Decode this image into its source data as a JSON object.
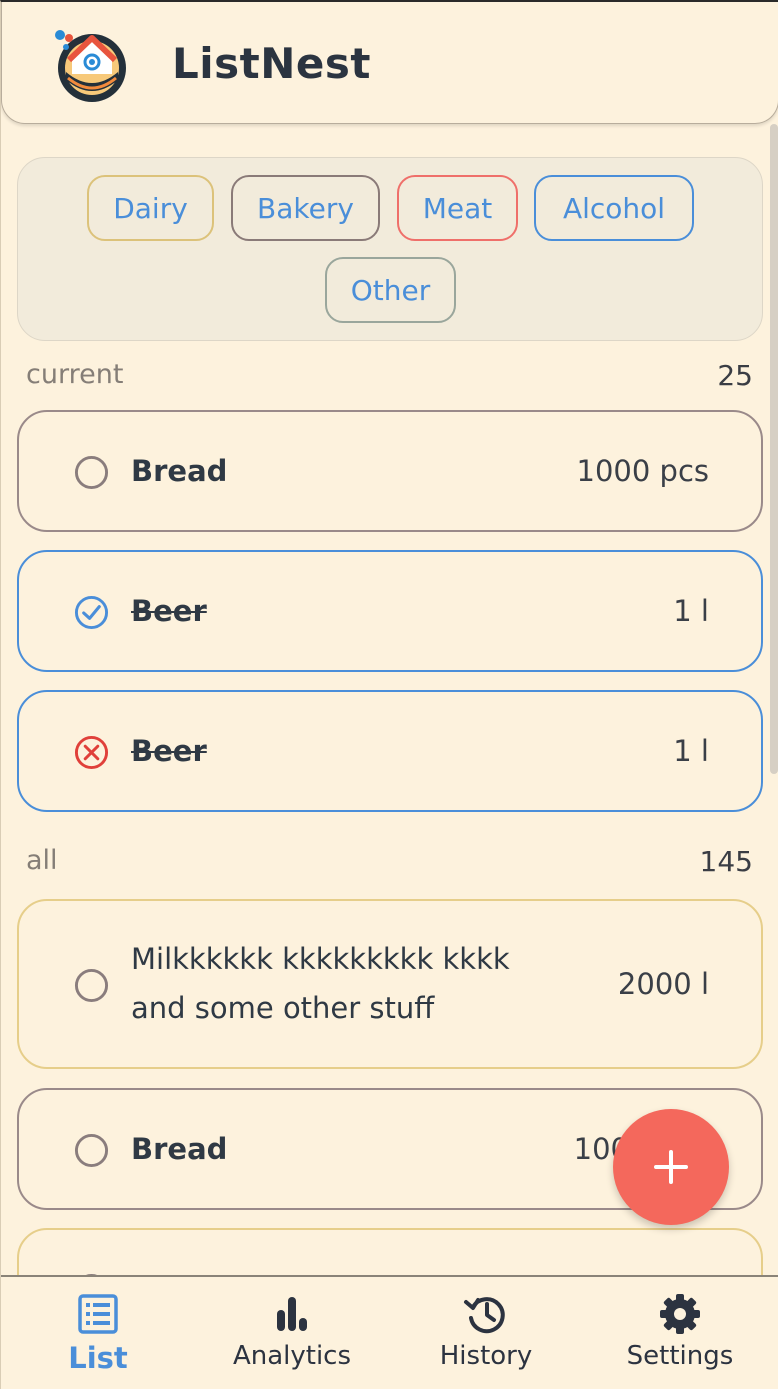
{
  "app": {
    "title": "ListNest"
  },
  "categories": [
    {
      "label": "Dairy",
      "border_color": "#dcc27a"
    },
    {
      "label": "Bakery",
      "border_color": "#8a7a78"
    },
    {
      "label": "Meat",
      "border_color": "#ef6f6a"
    },
    {
      "label": "Alcohol",
      "border_color": "#4a8ed9"
    },
    {
      "label": "Other",
      "border_color": "#9aa69c"
    }
  ],
  "sections": {
    "current": {
      "label": "current",
      "count": "25"
    },
    "all": {
      "label": "all",
      "count": "145"
    }
  },
  "current_items": [
    {
      "name": "Bread",
      "quantity": "1000 pcs",
      "status": "unchecked",
      "category_color": "#9a8a8a"
    },
    {
      "name": "Beer",
      "quantity": "1 l",
      "status": "checked",
      "category_color": "#4a8ed9"
    },
    {
      "name": "Beer",
      "quantity": "1 l",
      "status": "cancelled",
      "category_color": "#4a8ed9"
    }
  ],
  "all_items": [
    {
      "name_line1": "Milkkkkkk kkkkkkkkk kkkk",
      "name_line2": "and some other stuff",
      "quantity": "2000 l",
      "status": "unchecked",
      "category_color": "#e6ce8a"
    },
    {
      "name": "Bread",
      "quantity": "100",
      "status": "unchecked",
      "category_color": "#9a8a8a"
    }
  ],
  "colors": {
    "accent": "#4a8ed9",
    "fab": "#f4685c",
    "background": "#fdf2dd",
    "danger": "#e0403a"
  },
  "fab": {
    "icon": "plus-icon"
  },
  "nav": [
    {
      "label": "List",
      "icon": "list-icon",
      "active": true
    },
    {
      "label": "Analytics",
      "icon": "bar-chart-icon",
      "active": false
    },
    {
      "label": "History",
      "icon": "history-icon",
      "active": false
    },
    {
      "label": "Settings",
      "icon": "gear-icon",
      "active": false
    }
  ]
}
